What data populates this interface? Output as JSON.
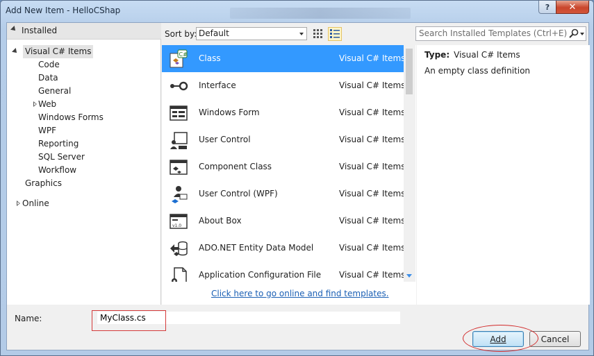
{
  "window": {
    "title": "Add New Item - HelloCShap",
    "help_label": "?",
    "close_label": "✕"
  },
  "tree": {
    "installed": "Installed",
    "visual_cs_items": "Visual C# Items",
    "children": [
      "Code",
      "Data",
      "General",
      "Web",
      "Windows Forms",
      "WPF",
      "Reporting",
      "SQL Server",
      "Workflow"
    ],
    "graphics": "Graphics",
    "online": "Online"
  },
  "toolbar": {
    "sort_label": "Sort by:",
    "sort_value": "Default",
    "search_placeholder": "Search Installed Templates (Ctrl+E)"
  },
  "templates": [
    {
      "name": "Class",
      "category": "Visual C# Items",
      "icon": "class-icon"
    },
    {
      "name": "Interface",
      "category": "Visual C# Items",
      "icon": "interface-icon"
    },
    {
      "name": "Windows Form",
      "category": "Visual C# Items",
      "icon": "windows-form-icon"
    },
    {
      "name": "User Control",
      "category": "Visual C# Items",
      "icon": "user-control-icon"
    },
    {
      "name": "Component Class",
      "category": "Visual C# Items",
      "icon": "component-class-icon"
    },
    {
      "name": "User Control (WPF)",
      "category": "Visual C# Items",
      "icon": "user-control-wpf-icon"
    },
    {
      "name": "About Box",
      "category": "Visual C# Items",
      "icon": "about-box-icon"
    },
    {
      "name": "ADO.NET Entity Data Model",
      "category": "Visual C# Items",
      "icon": "entity-data-model-icon"
    },
    {
      "name": "Application Configuration File",
      "category": "Visual C# Items",
      "icon": "config-file-icon"
    }
  ],
  "online_link": "Click here to go online and find templates.",
  "details": {
    "type_label": "Type:",
    "type_value": "Visual C# Items",
    "description": "An empty class definition"
  },
  "form": {
    "name_label": "Name:",
    "name_value": "MyClass.cs",
    "add_label": "Add",
    "cancel_label": "Cancel"
  },
  "colors": {
    "selection": "#3399ff",
    "link": "#1a5fb4",
    "annotation_red": "#d22a2a"
  }
}
